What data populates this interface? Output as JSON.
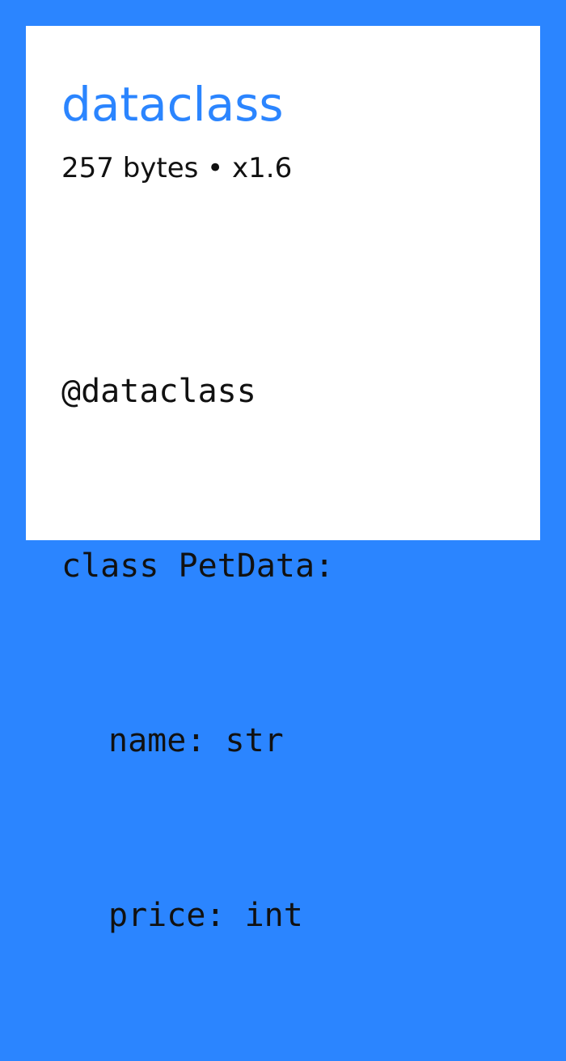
{
  "title": "dataclass",
  "stats": "257 bytes • x1.6",
  "code": {
    "line1": "@dataclass",
    "line2": "class PetData:",
    "line3": "name: str",
    "line4": "price: int"
  },
  "colors": {
    "accent": "#2b85ff",
    "background": "#ffffff",
    "text": "#111111"
  }
}
